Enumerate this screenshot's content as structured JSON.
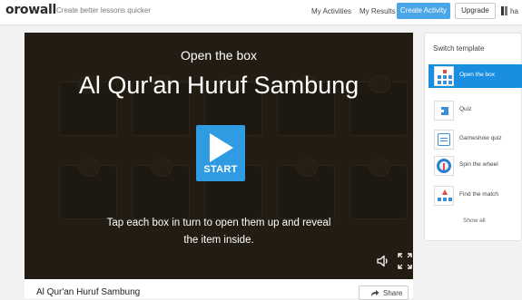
{
  "header": {
    "logo": "orowall",
    "tagline": "Create better lessons quicker",
    "nav": {
      "my_activities": "My Activities",
      "my_results": "My Results"
    },
    "create_activity": "Create Activity",
    "upgrade": "Upgrade",
    "user_name": "ha"
  },
  "game": {
    "template_name": "Open the box",
    "title": "Al Qur'an Huruf Sambung",
    "start_label": "START",
    "instructions": "Tap each box in turn to open them up and reveal the item inside."
  },
  "activity": {
    "title": "Al Qur'an Huruf Sambung",
    "share_label": "Share"
  },
  "switch_template": {
    "heading": "Switch template",
    "items": [
      {
        "label": "Open the box",
        "active": true,
        "icon": "open-the-box-icon"
      },
      {
        "label": "Quiz",
        "active": false,
        "icon": "quiz-icon"
      },
      {
        "label": "Gameshow quiz",
        "active": false,
        "icon": "gameshow-quiz-icon"
      },
      {
        "label": "Spin the wheel",
        "active": false,
        "icon": "spin-the-wheel-icon"
      },
      {
        "label": "Find the match",
        "active": false,
        "icon": "find-the-match-icon"
      }
    ],
    "show_all": "Show all"
  },
  "colors": {
    "accent": "#4aa6e8",
    "start_button": "#2f9be2",
    "active_template": "#1a8fe0",
    "stage_background": "#2a2218"
  }
}
